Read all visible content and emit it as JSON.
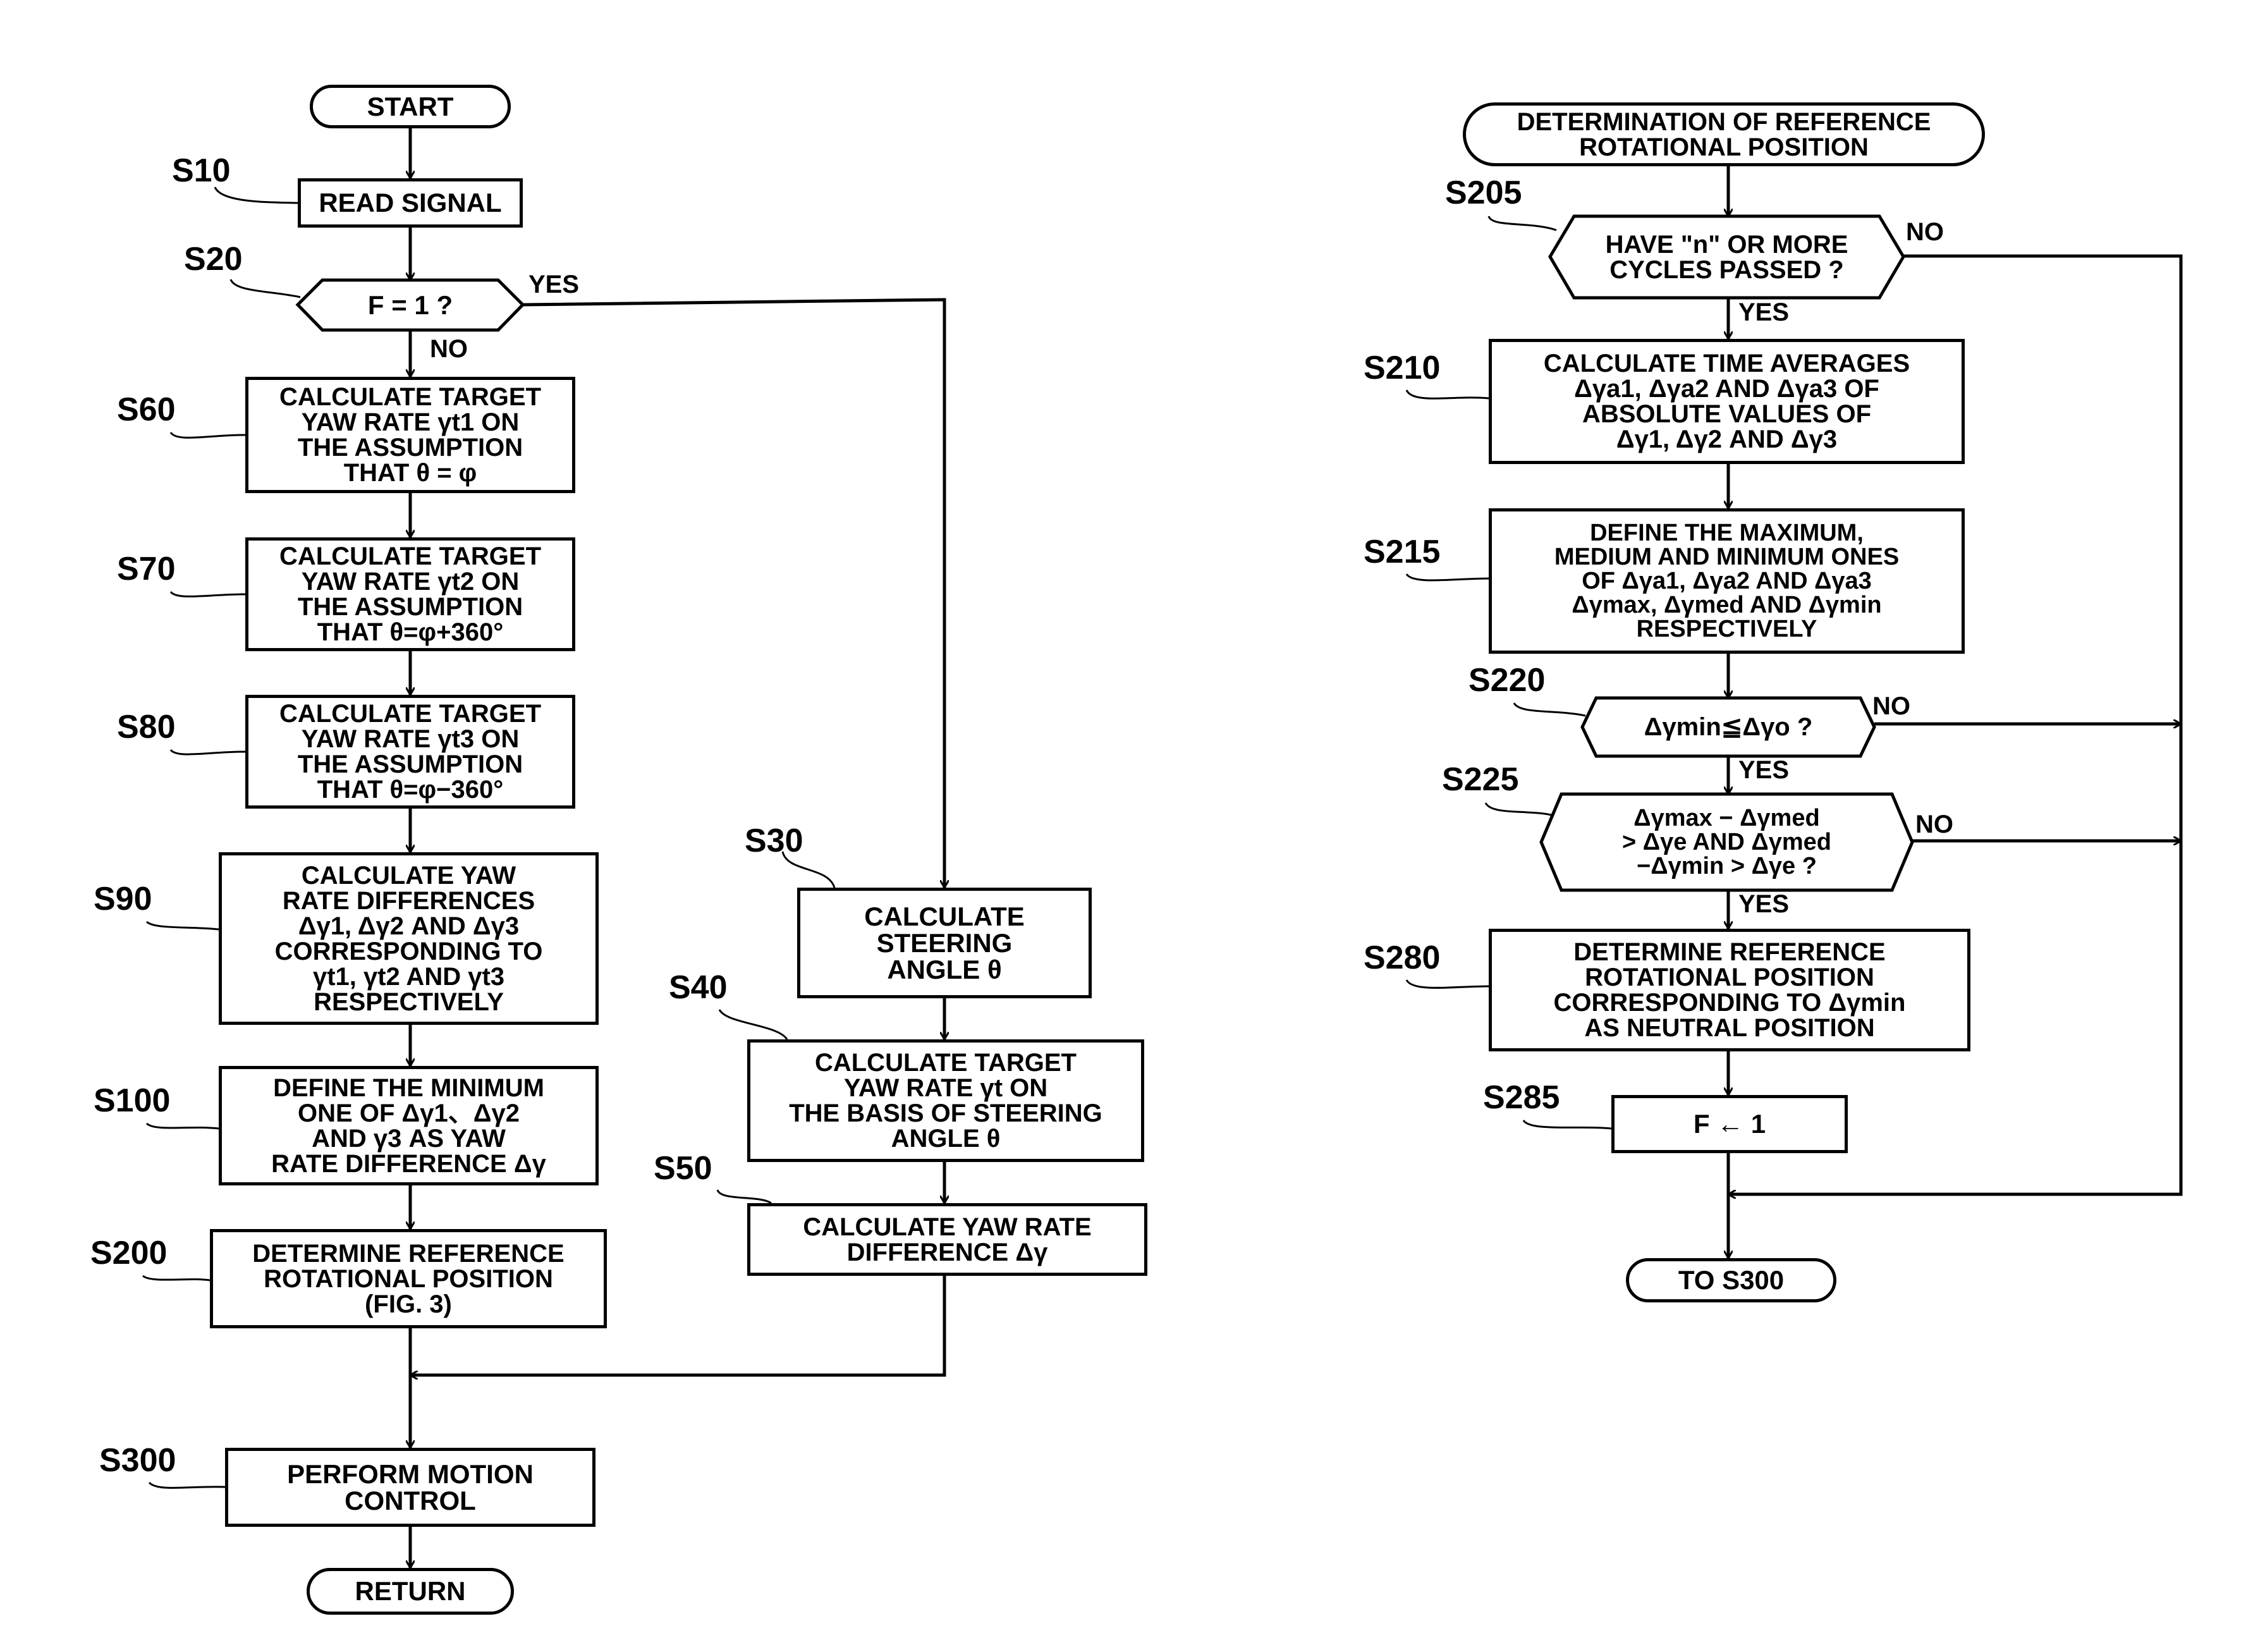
{
  "figure_left": {
    "start": "START",
    "s10": {
      "label": "S10",
      "text": "READ SIGNAL"
    },
    "s20": {
      "label": "S20",
      "text": "F = 1 ?",
      "yes": "YES",
      "no": "NO"
    },
    "s60": {
      "label": "S60",
      "text": "CALCULATE TARGET\nYAW RATE  γt1 ON\nTHE ASSUMPTION\nTHAT  θ = φ"
    },
    "s70": {
      "label": "S70",
      "text": "CALCULATE TARGET\nYAW RATE  γt2 ON\nTHE ASSUMPTION\nTHAT  θ=φ+360°"
    },
    "s80": {
      "label": "S80",
      "text": "CALCULATE TARGET\nYAW RATE  γt3 ON\nTHE ASSUMPTION\nTHAT  θ=φ−360°"
    },
    "s90": {
      "label": "S90",
      "text": "CALCULATE YAW\nRATE DIFFERENCES\nΔγ1, Δγ2 AND Δγ3\nCORRESPONDING TO\nγt1, γt2 AND γt3\nRESPECTIVELY"
    },
    "s100": {
      "label": "S100",
      "text": "DEFINE THE MINIMUM\nONE OF Δγ1、Δγ2\nAND γ3 AS YAW\nRATE DIFFERENCE Δγ"
    },
    "s200": {
      "label": "S200",
      "text": "DETERMINE REFERENCE\nROTATIONAL POSITION\n(FIG. 3)"
    },
    "s30": {
      "label": "S30",
      "text": "CALCULATE\nSTEERING\nANGLE θ"
    },
    "s40": {
      "label": "S40",
      "text": "CALCULATE TARGET\nYAW RATE γt ON\nTHE BASIS OF STEERING\nANGLE θ"
    },
    "s50": {
      "label": "S50",
      "text": "CALCULATE YAW RATE\nDIFFERENCE Δγ"
    },
    "s300": {
      "label": "S300",
      "text": "PERFORM MOTION\nCONTROL"
    },
    "return": "RETURN"
  },
  "figure_right": {
    "start": "DETERMINATION OF REFERENCE\nROTATIONAL POSITION",
    "s205": {
      "label": "S205",
      "text": "HAVE \"n\" OR MORE\nCYCLES PASSED ?",
      "yes": "YES",
      "no": "NO"
    },
    "s210": {
      "label": "S210",
      "text": "CALCULATE TIME AVERAGES\nΔγa1, Δγa2 AND Δγa3 OF\nABSOLUTE VALUES OF\nΔγ1, Δγ2 AND Δγ3"
    },
    "s215": {
      "label": "S215",
      "text": "DEFINE THE MAXIMUM,\nMEDIUM AND MINIMUM ONES\nOF Δγa1, Δγa2 AND Δγa3\nΔγmax, Δγmed AND Δγmin\nRESPECTIVELY"
    },
    "s220": {
      "label": "S220",
      "text": "Δγmin≦Δγo ?",
      "yes": "YES",
      "no": "NO"
    },
    "s225": {
      "label": "S225",
      "text": "Δγmax − Δγmed\n> Δγe AND Δγmed\n−Δγmin > Δγe ?",
      "yes": "YES",
      "no": "NO"
    },
    "s280": {
      "label": "S280",
      "text": "DETERMINE REFERENCE\nROTATIONAL POSITION\nCORRESPONDING TO Δγmin\nAS NEUTRAL POSITION"
    },
    "s285": {
      "label": "S285",
      "text": "F ← 1"
    },
    "end": "TO S300"
  }
}
